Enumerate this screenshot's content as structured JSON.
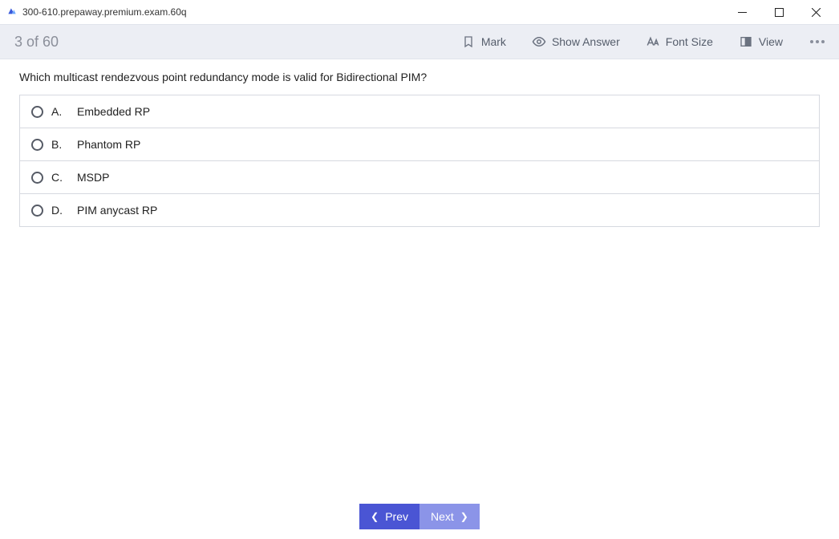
{
  "window": {
    "title": "300-610.prepaway.premium.exam.60q"
  },
  "toolbar": {
    "progress": "3 of 60",
    "mark_label": "Mark",
    "show_answer_label": "Show Answer",
    "font_size_label": "Font Size",
    "view_label": "View"
  },
  "question": {
    "text": "Which multicast rendezvous point redundancy mode is valid for Bidirectional PIM?"
  },
  "options": [
    {
      "letter": "A.",
      "text": "Embedded RP"
    },
    {
      "letter": "B.",
      "text": "Phantom RP"
    },
    {
      "letter": "C.",
      "text": "MSDP"
    },
    {
      "letter": "D.",
      "text": "PIM anycast RP"
    }
  ],
  "footer": {
    "prev_label": "Prev",
    "next_label": "Next"
  }
}
